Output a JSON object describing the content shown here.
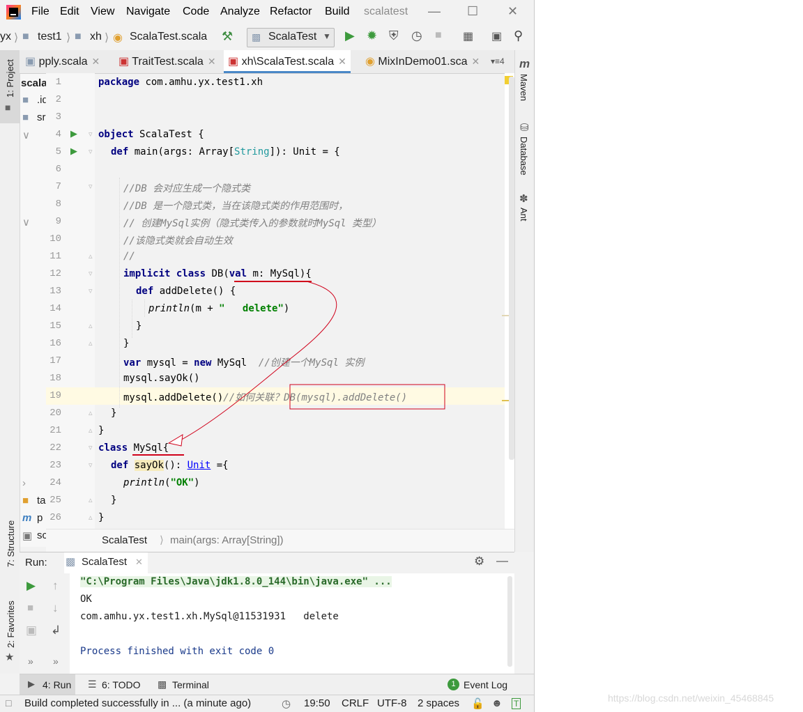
{
  "menu": {
    "file": "File",
    "edit": "Edit",
    "view": "View",
    "navigate": "Navigate",
    "code": "Code",
    "analyze": "Analyze",
    "refactor": "Refactor",
    "build": "Build",
    "project_name": "scalatest"
  },
  "toolbar": {
    "crumbs": [
      "yx",
      "test1",
      "xh",
      "ScalaTest.scala"
    ],
    "run_config": "ScalaTest"
  },
  "tabs": [
    {
      "label": "pply.scala"
    },
    {
      "label": "TraitTest.scala"
    },
    {
      "label": "xh\\ScalaTest.scala"
    },
    {
      "label": "MixInDemo01.sca"
    }
  ],
  "tabs_more": "4",
  "left_tools": {
    "project": "1: Project",
    "structure": "7: Structure",
    "favorites": "2: Favorites"
  },
  "right_tools": {
    "maven": "Maven",
    "database": "Database",
    "ant": "Ant"
  },
  "project_tree": [
    "scala",
    ".id",
    "sr",
    "ta",
    "p",
    "sc"
  ],
  "editor": {
    "line_numbers": [
      "1",
      "2",
      "3",
      "4",
      "5",
      "6",
      "7",
      "8",
      "9",
      "10",
      "11",
      "12",
      "13",
      "14",
      "15",
      "16",
      "17",
      "18",
      "19",
      "20",
      "21",
      "22",
      "23",
      "24",
      "25",
      "26"
    ],
    "lines": {
      "l1_kw": "package",
      "l1_rest": " com.amhu.yx.test1.xh",
      "l4_kw": "object",
      "l4_rest": " ScalaTest {",
      "l5_kw": "def",
      "l5_a": " main(args: Array[",
      "l5_type": "String",
      "l5_b": "]): Unit = {",
      "l7": "//DB 会对应生成一个隐式类",
      "l8": "//DB 是一个隐式类，当在该隐式类的作用范围时，",
      "l9": "// 创建MySql实例（隐式类传入的参数就时MySql 类型）",
      "l10": "//该隐式类就会自动生效",
      "l11": "//",
      "l12_kw1": "implicit",
      "l12_kw2": "class",
      "l12_a": " DB(",
      "l12_kw3": "val",
      "l12_b": " m: MySql){",
      "l13_kw": "def",
      "l13_rest": " addDelete() {",
      "l14_fn": "println",
      "l14_a": "(m + ",
      "l14_str": "\"   delete\"",
      "l14_b": ")",
      "l15": "}",
      "l16": "}",
      "l17_kw1": "var",
      "l17_a": " mysql = ",
      "l17_kw2": "new",
      "l17_b": " MySql  ",
      "l17_cm": "//创建一个MySql 实例",
      "l18": "mysql.sayOk()",
      "l19_a": "mysql.addDelete()",
      "l19_cm": "//如何关联？DB(mysql).addDelete()",
      "l20": "}",
      "l21": "}",
      "l22_kw": "class",
      "l22_rest": " MySql{",
      "l23_kw": "def",
      "l23_fn": "sayOk",
      "l23_a": "(): ",
      "l23_type": "Unit",
      "l23_b": " ={",
      "l24_fn": "println",
      "l24_a": "(",
      "l24_str": "\"OK\"",
      "l24_b": ")",
      "l25": "}",
      "l26": "}"
    }
  },
  "breadcrumb": {
    "class": "ScalaTest",
    "method": "main(args: Array[String])"
  },
  "run": {
    "label": "Run:",
    "tab": "ScalaTest",
    "output": [
      "\"C:\\Program Files\\Java\\jdk1.8.0_144\\bin\\java.exe\" ...",
      "OK",
      "com.amhu.yx.test1.xh.MySql@11531931   delete",
      "",
      "Process finished with exit code 0"
    ]
  },
  "bottom_tools": {
    "run": "4: Run",
    "todo": "6: TODO",
    "terminal": "Terminal",
    "event_log": "Event Log",
    "event_count": "1"
  },
  "status": {
    "message": "Build completed successfully in ... (a minute ago)",
    "position": "19:50",
    "line_sep": "CRLF",
    "encoding": "UTF-8",
    "indent": "2 spaces"
  },
  "watermark": "https://blog.csdn.net/weixin_45468845",
  "colors": {
    "keyword": "#000080",
    "comment": "#808080",
    "string": "#008000",
    "annotation": "#d0021b",
    "accent": "#4a88c7"
  }
}
